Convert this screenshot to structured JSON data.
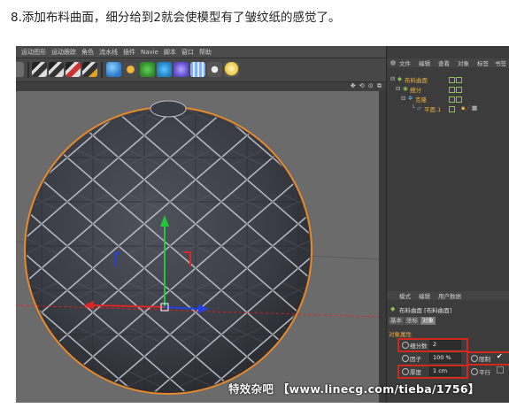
{
  "caption": "8.添加布料曲面，细分给到2就会使模型有了皱纹纸的感觉了。",
  "menubar": {
    "items": [
      "运动图形",
      "运动跟踪",
      "角色",
      "流水线",
      "插件",
      "Navie",
      "脚本",
      "窗口",
      "帮助"
    ]
  },
  "viewport": {
    "controls": "✥ ⟲ ⊙ ⧉"
  },
  "object_manager": {
    "tabs": [
      "文件",
      "编辑",
      "查看",
      "对象",
      "标签",
      "书签"
    ],
    "objects": [
      {
        "label": "布料曲面"
      },
      {
        "label": "细分"
      },
      {
        "label": "克隆"
      },
      {
        "label": "平面.1"
      }
    ]
  },
  "attributes": {
    "tabs": [
      "模式",
      "编辑",
      "用户数据"
    ],
    "title": "布料曲面 [布料曲面]",
    "sub_tabs": [
      "基本",
      "坐标",
      "对象"
    ],
    "section": "对象属性",
    "fields": {
      "subdivisions": {
        "label": "细分数",
        "value": "2"
      },
      "factor": {
        "label": "因子",
        "value": "100 %"
      },
      "thickness": {
        "label": "厚度",
        "value": "1 cm"
      },
      "limit": {
        "label": "限制"
      },
      "parallel": {
        "label": "平行"
      }
    }
  },
  "watermark": "特效杂吧 【www.linecg.com/tieba/1756】",
  "colors": {
    "highlight": "#d6281a",
    "object_text": "#e6b04a",
    "axis_x": "#e02424",
    "axis_y": "#22c73a",
    "axis_z": "#2440e0",
    "selection_outline": "#e8892a"
  }
}
